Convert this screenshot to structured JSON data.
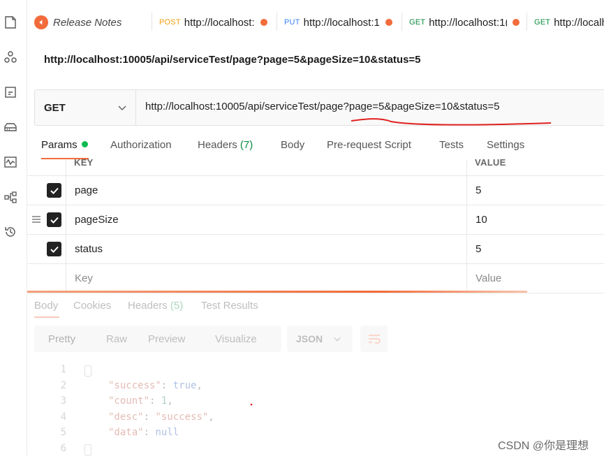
{
  "tabs": [
    {
      "method": "",
      "label": "Release Notes"
    },
    {
      "method": "POST",
      "label": "http://localhost:"
    },
    {
      "method": "PUT",
      "label": "http://localhost:1"
    },
    {
      "method": "GET",
      "label": "http://localhost:1("
    },
    {
      "method": "GET",
      "label": "http://localh"
    }
  ],
  "request": {
    "title": "http://localhost:10005/api/serviceTest/page?page=5&pageSize=10&status=5",
    "method": "GET",
    "url": "http://localhost:10005/api/serviceTest/page?page=5&pageSize=10&status=5"
  },
  "subtabs": {
    "params": "Params",
    "authorization": "Authorization",
    "headers": "Headers",
    "headers_count": "(7)",
    "body": "Body",
    "prerequest": "Pre-request Script",
    "tests": "Tests",
    "settings": "Settings"
  },
  "params": {
    "key_header": "KEY",
    "value_header": "VALUE",
    "rows": [
      {
        "key": "page",
        "value": "5"
      },
      {
        "key": "pageSize",
        "value": "10"
      },
      {
        "key": "status",
        "value": "5"
      }
    ],
    "key_placeholder": "Key",
    "value_placeholder": "Value"
  },
  "response": {
    "tabs": {
      "body": "Body",
      "cookies": "Cookies",
      "headers": "Headers",
      "headers_count": "(5)",
      "test_results": "Test Results"
    },
    "formats": {
      "pretty": "Pretty",
      "raw": "Raw",
      "preview": "Preview",
      "visualize": "Visualize"
    },
    "json_select": "JSON",
    "code": {
      "line_numbers": [
        "1",
        "2",
        "3",
        "4",
        "5",
        "6"
      ],
      "success_key": "\"success\"",
      "success_val": "true",
      "count_key": "\"count\"",
      "count_val": "1",
      "desc_key": "\"desc\"",
      "desc_val": "\"success\"",
      "data_key": "\"data\"",
      "data_val": "null"
    }
  },
  "watermark": "CSDN @你是理想",
  "colors": {
    "accent": "#f26b3a",
    "get": "#0a8a3f",
    "post": "#f59e0b",
    "put": "#3b82f6",
    "annotation": "#e02020"
  }
}
